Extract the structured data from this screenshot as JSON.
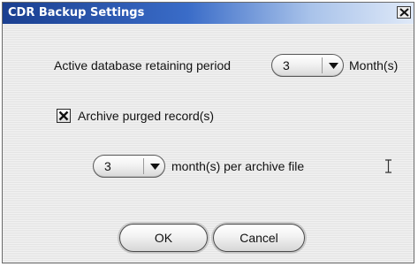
{
  "window": {
    "title": "CDR Backup Settings",
    "close_icon": "close-icon"
  },
  "retention": {
    "label": "Active database retaining period",
    "value": "3",
    "unit": "Month(s)"
  },
  "archive": {
    "checkbox_label": "Archive purged record(s)",
    "checked": true
  },
  "archive_file": {
    "value": "3",
    "label": "month(s) per archive file"
  },
  "buttons": {
    "ok": "OK",
    "cancel": "Cancel"
  }
}
